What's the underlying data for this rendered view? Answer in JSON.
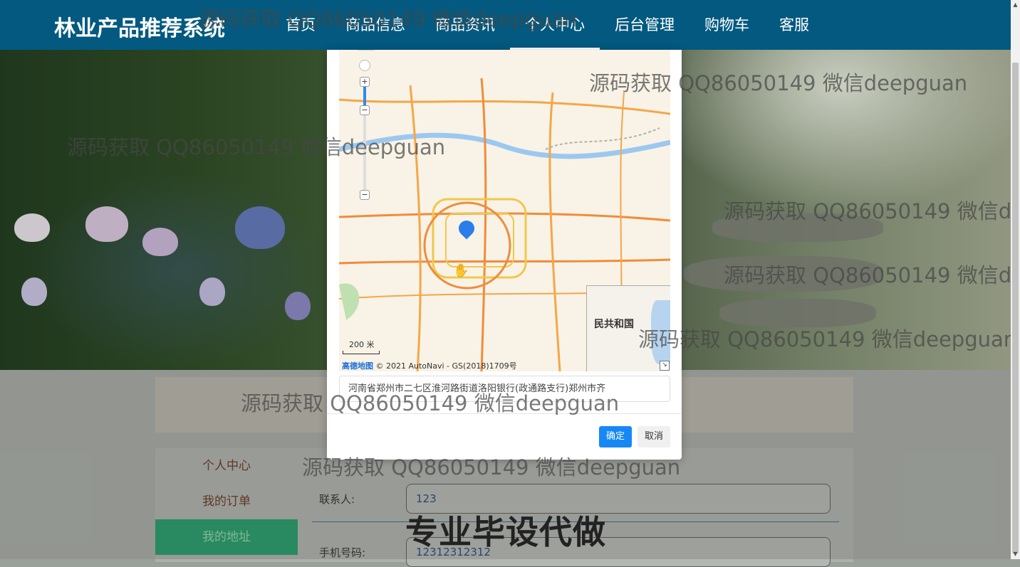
{
  "header": {
    "brand": "林业产品推荐系统",
    "nav": [
      "首页",
      "商品信息",
      "商品资讯",
      "个人中心",
      "后台管理",
      "购物车",
      "客服"
    ],
    "active_nav": "个人中心"
  },
  "sidebar": {
    "items": [
      "个人中心",
      "我的订单",
      "我的地址"
    ],
    "active": "我的地址"
  },
  "form": {
    "contact_label": "联系人:",
    "contact_value": "123",
    "phone_label": "手机号码:",
    "phone_value": "12312312312"
  },
  "modal": {
    "map": {
      "scale": "200 米",
      "copyright_logo": "高德地图",
      "copyright": "© 2021 AutoNavi - GS(2018)1709号",
      "overview_label": "民共和国"
    },
    "address": "河南省郑州市二七区淮河路街道洛阳银行(政通路支行)郑州市齐",
    "ok_label": "确定",
    "cancel_label": "取消"
  },
  "watermarks": [
    "源码获取 QQ86050149 微信deepguan",
    "源码获取 QQ86050149 微信deepguan",
    "源码获取 QQ86050149 微信deepguan",
    "源码获取 QQ86050149 微信de",
    "源码获取 QQ86050149 微信de",
    "源码获取 QQ86050149 微信deepguan",
    "源码获取 QQ86050149 微信deepguan",
    "源码获取 QQ86050149 微信deepguan"
  ],
  "promo": "专业毕设代做",
  "colors": {
    "nav_bg": "#03597f",
    "accent_green": "#2a9a6a",
    "ok_button": "#1688f6",
    "map_pin": "#2b7de9"
  }
}
